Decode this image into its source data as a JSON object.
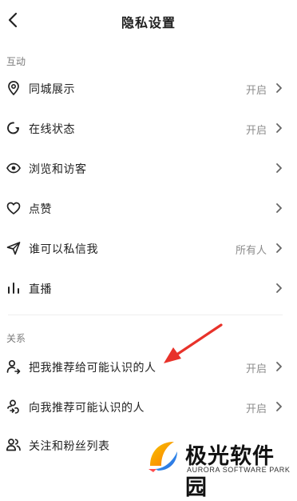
{
  "header": {
    "title": "隐私设置"
  },
  "sections": [
    {
      "label": "互动"
    },
    {
      "label": "关系"
    }
  ],
  "rows": [
    {
      "label": "同城展示",
      "value": "开启",
      "icon": "location-pin-icon"
    },
    {
      "label": "在线状态",
      "value": "开启",
      "icon": "online-status-icon"
    },
    {
      "label": "浏览和访客",
      "value": "",
      "icon": "eye-icon"
    },
    {
      "label": "点赞",
      "value": "",
      "icon": "heart-icon"
    },
    {
      "label": "谁可以私信我",
      "value": "所有人",
      "icon": "send-icon"
    },
    {
      "label": "直播",
      "value": "",
      "icon": "bar-chart-icon"
    },
    {
      "label": "把我推荐给可能认识的人",
      "value": "开启",
      "icon": "user-share-icon"
    },
    {
      "label": "向我推荐可能认识的人",
      "value": "开启",
      "icon": "user-recommend-icon"
    },
    {
      "label": "关注和粉丝列表",
      "value": "",
      "icon": "users-icon"
    }
  ],
  "watermark": {
    "name": "极光软件园",
    "subtitle": "AURORA SOFTWARE PARK"
  },
  "colors": {
    "annotation_arrow": "#e8322a",
    "text_primary": "#222222",
    "text_secondary": "#8c8c8c"
  }
}
